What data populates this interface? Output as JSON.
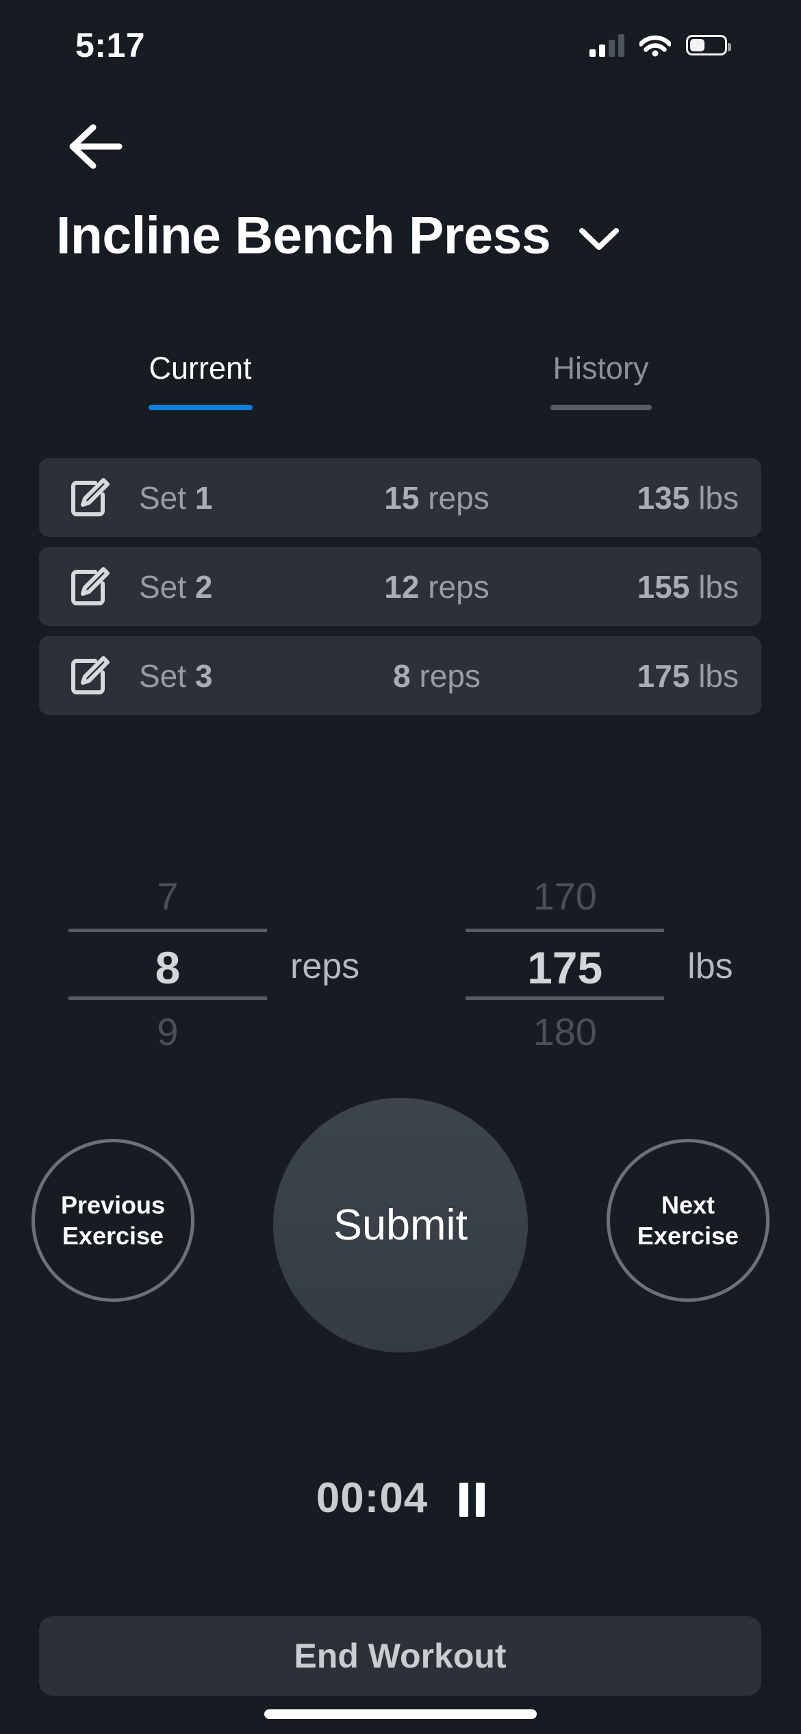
{
  "status_bar": {
    "time": "5:17",
    "cellular_icon": "cellular-signal-icon",
    "wifi_icon": "wifi-icon",
    "battery_icon": "battery-icon",
    "battery_level_percent": 38
  },
  "nav": {
    "back_icon": "back-arrow-icon"
  },
  "header": {
    "title": "Incline Bench Press",
    "dropdown_icon": "chevron-down-icon"
  },
  "tabs": [
    {
      "label": "Current",
      "active": true
    },
    {
      "label": "History",
      "active": false
    }
  ],
  "sets": [
    {
      "edit_icon": "edit-icon",
      "set_word": "Set",
      "set_number": "1",
      "reps": "15",
      "reps_unit": "reps",
      "weight": "135",
      "weight_unit": "lbs"
    },
    {
      "edit_icon": "edit-icon",
      "set_word": "Set",
      "set_number": "2",
      "reps": "12",
      "reps_unit": "reps",
      "weight": "155",
      "weight_unit": "lbs"
    },
    {
      "edit_icon": "edit-icon",
      "set_word": "Set",
      "set_number": "3",
      "reps": "8",
      "reps_unit": "reps",
      "weight": "175",
      "weight_unit": "lbs"
    }
  ],
  "pickers": {
    "reps": {
      "above": "7",
      "selected": "8",
      "below": "9",
      "unit": "reps"
    },
    "weight": {
      "above": "170",
      "selected": "175",
      "below": "180",
      "unit": "lbs"
    }
  },
  "actions": {
    "previous": {
      "line1": "Previous",
      "line2": "Exercise"
    },
    "submit": "Submit",
    "next": {
      "line1": "Next",
      "line2": "Exercise"
    }
  },
  "timer": {
    "value": "00:04",
    "pause_icon": "pause-icon"
  },
  "footer": {
    "end_workout": "End Workout"
  },
  "colors": {
    "background": "#171b22",
    "card": "#2c3138",
    "accent_blue": "#0c7fdd",
    "inactive_gray": "#575d66",
    "text_primary": "#ffffff",
    "text_secondary": "#989da4"
  }
}
